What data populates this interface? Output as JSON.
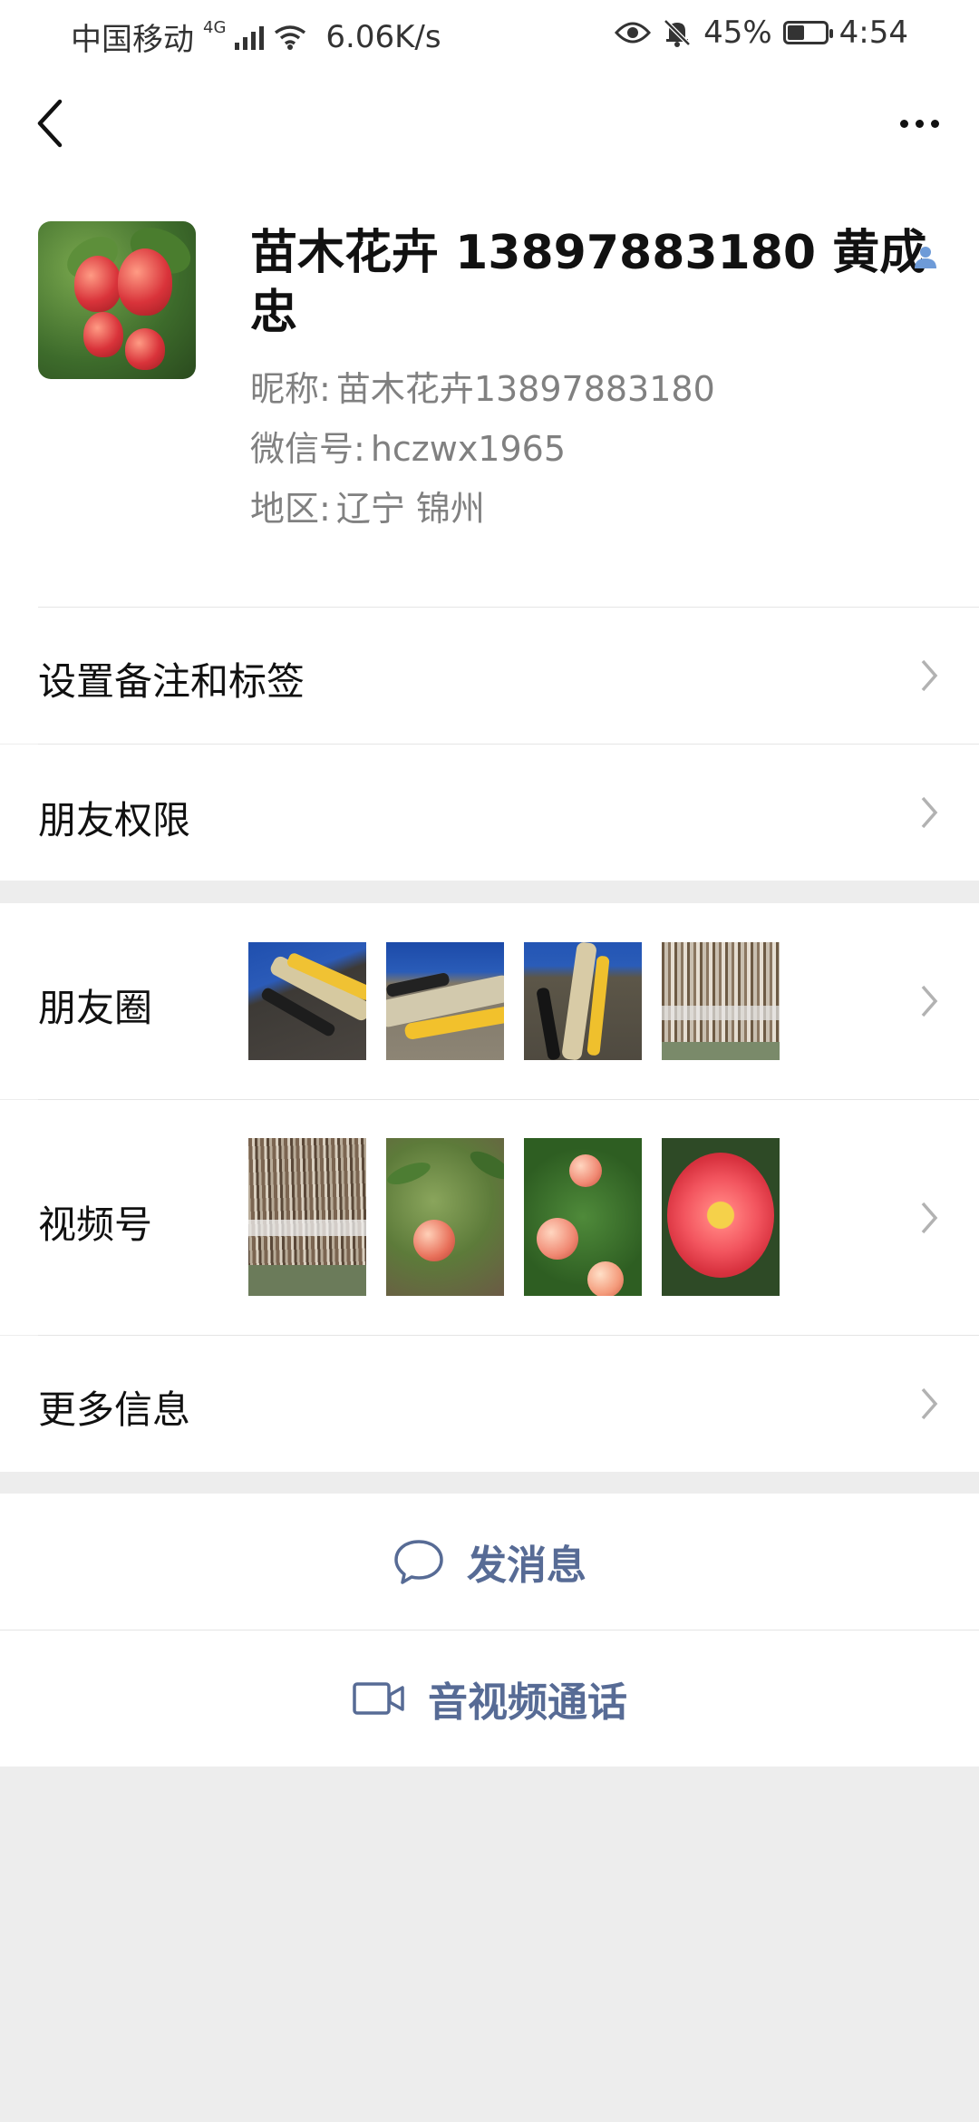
{
  "status_bar": {
    "carrier": "中国移动",
    "network": "4G",
    "speed": "6.06K/s",
    "battery": "45%",
    "battery_level": 0.45,
    "time": "4:54"
  },
  "profile": {
    "display_name": "苗木花卉 13897883180  黄成忠",
    "nickname_label": "昵称:",
    "nickname": "苗木花卉13897883180",
    "wechat_id_label": "微信号:",
    "wechat_id": "hczwx1965",
    "region_label": "地区:",
    "region": "辽宁  锦州"
  },
  "menu": {
    "remark_tags": "设置备注和标签",
    "friend_permissions": "朋友权限",
    "moments": "朋友圈",
    "channels": "视频号",
    "more_info": "更多信息"
  },
  "actions": {
    "send_message": "发消息",
    "av_call": "音视频通话"
  },
  "colors": {
    "link_blue": "#576b95",
    "background": "#ededed"
  }
}
